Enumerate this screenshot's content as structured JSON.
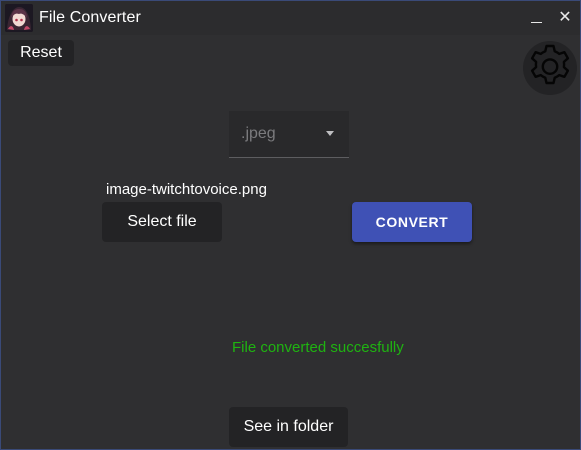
{
  "window": {
    "title": "File Converter",
    "minimize_label": "",
    "close_label": "✕"
  },
  "toolbar": {
    "reset_label": "Reset",
    "settings_icon": "gear-icon"
  },
  "format_select": {
    "value": ".jpeg"
  },
  "file": {
    "name": "image-twitchtovoice.png",
    "select_label": "Select file"
  },
  "convert_label": "CONVERT",
  "status": {
    "message": "File converted succesfully",
    "color": "#1fb311"
  },
  "see_folder_label": "See in folder",
  "colors": {
    "accent": "#3f51b5",
    "background": "#2f2f31",
    "button": "#232325"
  }
}
